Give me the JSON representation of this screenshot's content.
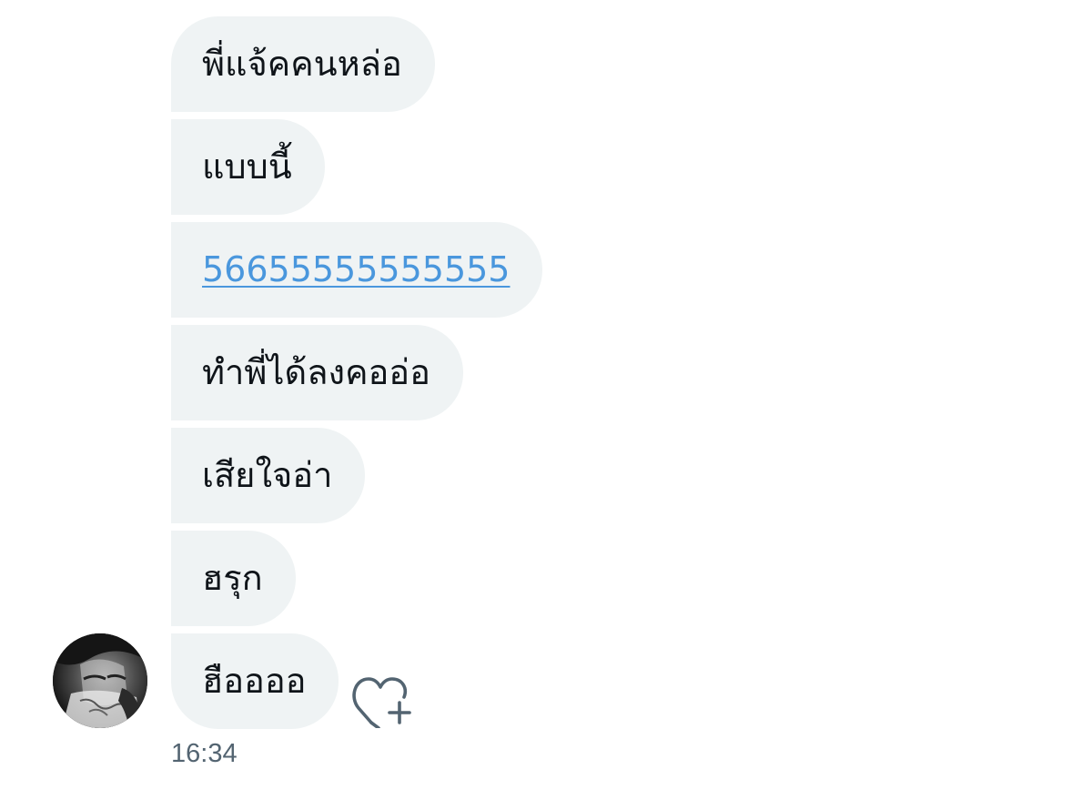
{
  "messages": [
    {
      "text": "พี่แจ้คคนหล่อ",
      "type": "text"
    },
    {
      "text": "แบบนี้",
      "type": "text"
    },
    {
      "text": "56655555555555",
      "type": "link"
    },
    {
      "text": "ทำพี่ได้ลงคออ่อ",
      "type": "text"
    },
    {
      "text": "เสียใจอ่า",
      "type": "text"
    },
    {
      "text": "ฮรุก",
      "type": "text"
    },
    {
      "text": "ฮืออออ",
      "type": "text"
    }
  ],
  "timestamp": "16:34",
  "icons": {
    "avatar": "sender-avatar",
    "reaction": "heart-plus-icon"
  },
  "colors": {
    "bubble_bg": "#eff3f4",
    "text": "#0f1419",
    "link": "#4a97dd",
    "timestamp": "#536471",
    "icon": "#536471"
  }
}
